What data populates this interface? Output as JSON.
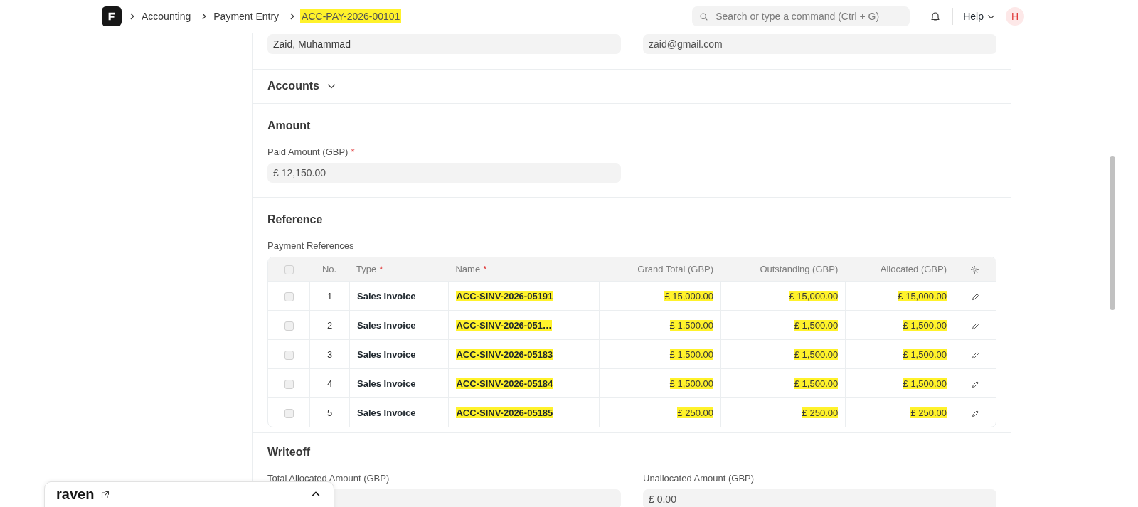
{
  "navbar": {
    "breadcrumbs": [
      {
        "label": "Accounting",
        "highlighted": false
      },
      {
        "label": "Payment Entry",
        "highlighted": false
      },
      {
        "label": "ACC-PAY-2026-00101",
        "highlighted": true
      }
    ],
    "search": {
      "placeholder": "Search or type a command (Ctrl + G)"
    },
    "help": "Help",
    "avatar": "H"
  },
  "party_fields": [
    {
      "value": "Zaid, Muhammad"
    },
    {
      "value": "zaid@gmail.com"
    }
  ],
  "accounts_section": {
    "title": "Accounts",
    "expanded": false
  },
  "amount_section": {
    "title": "Amount",
    "fields": [
      {
        "label": "Paid Amount (GBP)",
        "required_mark": "*",
        "value": "£ 12,150.00"
      }
    ]
  },
  "reference_section": {
    "title": "Reference",
    "table": {
      "label": "Payment References",
      "header_checked": false,
      "columns": [
        {
          "label": "No.",
          "kind": "number"
        },
        {
          "label": "Type",
          "kind": "text",
          "required_mark": "*"
        },
        {
          "label": "Name",
          "kind": "text",
          "required_mark": "*"
        },
        {
          "label": "Grand Total (GBP)",
          "kind": "currency"
        },
        {
          "label": "Outstanding (GBP)",
          "kind": "currency"
        },
        {
          "label": "Allocated (GBP)",
          "kind": "currency"
        }
      ],
      "rows": [
        {
          "checked": false,
          "cells": [
            {
              "text": "1",
              "highlighted": false
            },
            {
              "text": "Sales Invoice",
              "highlighted": false
            },
            {
              "text": "ACC-SINV-2026-05191",
              "highlighted": true
            },
            {
              "text": "£ 15,000.00",
              "highlighted": true
            },
            {
              "text": "£ 15,000.00",
              "highlighted": true
            },
            {
              "text": "£ 15,000.00",
              "highlighted": true
            }
          ]
        },
        {
          "checked": false,
          "cells": [
            {
              "text": "2",
              "highlighted": false
            },
            {
              "text": "Sales Invoice",
              "highlighted": false
            },
            {
              "text": "ACC-SINV-2026-051…",
              "highlighted": true
            },
            {
              "text": "£ 1,500.00",
              "highlighted": true
            },
            {
              "text": "£ 1,500.00",
              "highlighted": true
            },
            {
              "text": "£ 1,500.00",
              "highlighted": true
            }
          ]
        },
        {
          "checked": false,
          "cells": [
            {
              "text": "3",
              "highlighted": false
            },
            {
              "text": "Sales Invoice",
              "highlighted": false
            },
            {
              "text": "ACC-SINV-2026-05183",
              "highlighted": true
            },
            {
              "text": "£ 1,500.00",
              "highlighted": true
            },
            {
              "text": "£ 1,500.00",
              "highlighted": true
            },
            {
              "text": "£ 1,500.00",
              "highlighted": true
            }
          ]
        },
        {
          "checked": false,
          "cells": [
            {
              "text": "4",
              "highlighted": false
            },
            {
              "text": "Sales Invoice",
              "highlighted": false
            },
            {
              "text": "ACC-SINV-2026-05184",
              "highlighted": true
            },
            {
              "text": "£ 1,500.00",
              "highlighted": true
            },
            {
              "text": "£ 1,500.00",
              "highlighted": true
            },
            {
              "text": "£ 1,500.00",
              "highlighted": true
            }
          ]
        },
        {
          "checked": false,
          "cells": [
            {
              "text": "5",
              "highlighted": false
            },
            {
              "text": "Sales Invoice",
              "highlighted": false
            },
            {
              "text": "ACC-SINV-2026-05185",
              "highlighted": true
            },
            {
              "text": "£ 250.00",
              "highlighted": true
            },
            {
              "text": "£ 250.00",
              "highlighted": true
            },
            {
              "text": "£ 250.00",
              "highlighted": true
            }
          ]
        }
      ]
    }
  },
  "writeoff_section": {
    "title": "Writeoff",
    "fields": [
      {
        "label": "Total Allocated Amount (GBP)"
      },
      {
        "label": "Unallocated Amount (GBP)",
        "value": "£ 0.00"
      }
    ]
  },
  "raven_widget": {
    "title": "raven",
    "expanded": false
  }
}
